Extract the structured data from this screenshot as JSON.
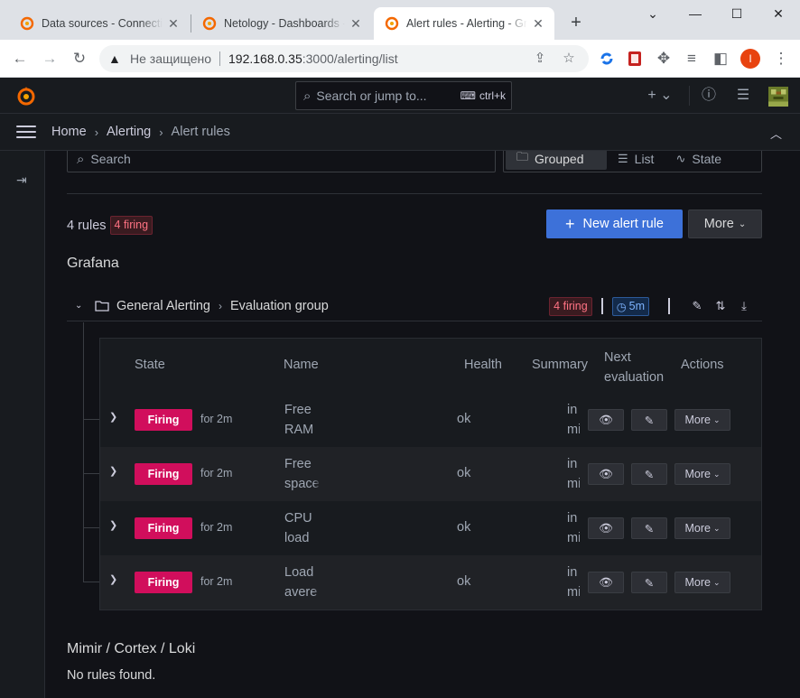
{
  "browser": {
    "tabs": [
      {
        "title": "Data sources - Connections"
      },
      {
        "title": "Netology - Dashboards - Grafana"
      },
      {
        "title": "Alert rules - Alerting - Grafana"
      }
    ],
    "insecure_label": "Не защищено",
    "url_host": "192.168.0.35",
    "url_path": ":3000/alerting/list",
    "profile_initial": "I"
  },
  "grafana": {
    "search_placeholder": "Search or jump to...",
    "search_shortcut": "ctrl+k",
    "breadcrumb": [
      "Home",
      "Alerting",
      "Alert rules"
    ]
  },
  "filters": {
    "search_placeholder": "Search",
    "views": [
      "Grouped",
      "List",
      "State"
    ]
  },
  "summary": {
    "rule_count": "4 rules",
    "firing_badge": "4 firing",
    "new_rule_label": "New alert rule",
    "more_label": "More"
  },
  "datasource_title": "Grafana",
  "group": {
    "folder": "General Alerting",
    "name": "Evaluation group",
    "firing_badge": "4 firing",
    "interval": "5m"
  },
  "table": {
    "headers": {
      "state": "State",
      "name": "Name",
      "health": "Health",
      "summary": "Summary",
      "next_eval": "Next evaluation",
      "actions": "Actions"
    },
    "rows": [
      {
        "state": "Firing",
        "duration": "for 2m",
        "name": "Free RAM",
        "health": "ok",
        "summary": "in mi"
      },
      {
        "state": "Firing",
        "duration": "for 2m",
        "name": "Free space",
        "health": "ok",
        "summary": "in mi"
      },
      {
        "state": "Firing",
        "duration": "for 2m",
        "name": "CPU load",
        "health": "ok",
        "summary": "in mi"
      },
      {
        "state": "Firing",
        "duration": "for 2m",
        "name": "Load avere",
        "health": "ok",
        "summary": "in mi"
      }
    ],
    "more_label": "More"
  },
  "other_datasource": {
    "title": "Mimir / Cortex / Loki",
    "empty_text": "No rules found."
  },
  "colors": {
    "firing": "#d10e5c",
    "primary": "#3d71d9",
    "background": "#111217",
    "panel": "#181b1f"
  }
}
